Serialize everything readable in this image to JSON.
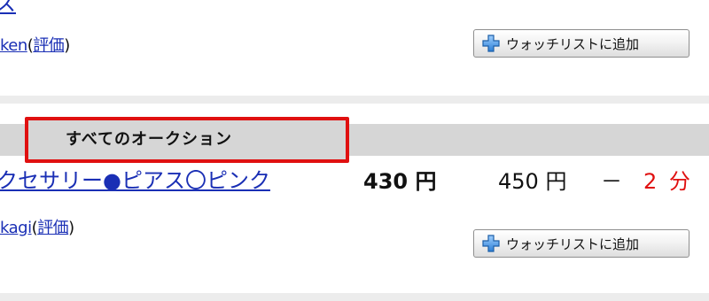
{
  "top_fragment": "ス",
  "listing1": {
    "seller_name": "ken",
    "paren_open": "(",
    "rating_link": "評価",
    "paren_close": ")",
    "watch_button": "ウォッチリストに追加"
  },
  "section": {
    "title": "すべてのオークション"
  },
  "listing2": {
    "title": "クセサリー●ピアス〇ピンク",
    "current_price": "430 円",
    "buyout_price": "450 円",
    "bids": "－",
    "time_left": "2 分",
    "seller_name": "kagi",
    "paren_open": "(",
    "rating_link": "評価",
    "paren_close": ")",
    "watch_button": "ウォッチリストに追加"
  },
  "colors": {
    "link": "#1a2fb5",
    "highlight": "#e01010",
    "section_band": "#d6d6d6",
    "separator": "#ececec"
  }
}
